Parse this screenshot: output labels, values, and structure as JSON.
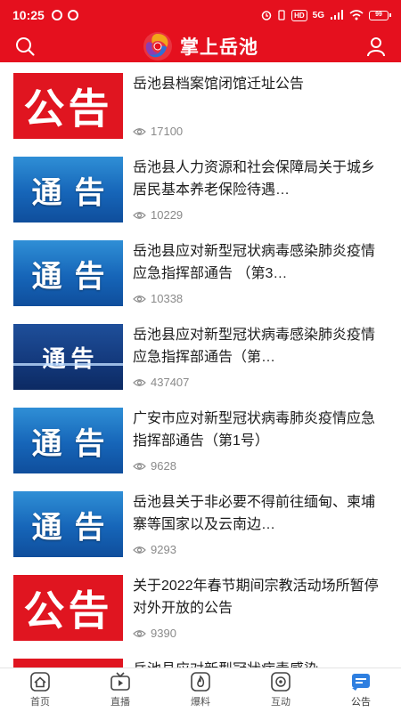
{
  "status_bar": {
    "time": "10:25",
    "network_badge": "HD",
    "signal_label": "5G",
    "battery": "99"
  },
  "header": {
    "title": "掌上岳池",
    "search_icon": "search-icon",
    "user_icon": "user-icon",
    "brand_colors": [
      "#e5101e",
      "#f2a51a",
      "#2e6fd6",
      "#8a3fb3"
    ]
  },
  "thumbnail_labels": {
    "gonggao": "公告",
    "tonggao": "通告"
  },
  "news": [
    {
      "thumb": "gonggao",
      "title": "岳池县档案馆闭馆迁址公告",
      "views": "17100"
    },
    {
      "thumb": "tonggao",
      "title": "岳池县人力资源和社会保障局关于城乡居民基本养老保险待遇…",
      "views": "10229"
    },
    {
      "thumb": "tonggao",
      "title": "岳池县应对新型冠状病毒感染肺炎疫情 应急指挥部通告 （第3…",
      "views": "10338"
    },
    {
      "thumb": "tonggao-dark",
      "title": "岳池县应对新型冠状病毒感染肺炎疫情应急指挥部通告（第…",
      "views": "437407"
    },
    {
      "thumb": "tonggao",
      "title": "广安市应对新型冠状病毒肺炎疫情应急指挥部通告（第1号）",
      "views": "9628"
    },
    {
      "thumb": "tonggao",
      "title": "岳池县关于非必要不得前往缅甸、柬埔寨等国家以及云南边…",
      "views": "9293"
    },
    {
      "thumb": "gonggao",
      "title": "关于2022年春节期间宗教活动场所暂停对外开放的公告",
      "views": "9390"
    },
    {
      "thumb": "gonggao",
      "title": "岳池县应对新型冠状病毒感染",
      "views": ""
    }
  ],
  "tabs": [
    {
      "label": "首页",
      "icon": "home-icon"
    },
    {
      "label": "直播",
      "icon": "tv-icon"
    },
    {
      "label": "爆料",
      "icon": "flame-icon"
    },
    {
      "label": "互动",
      "icon": "interact-icon"
    },
    {
      "label": "公告",
      "icon": "notice-icon"
    }
  ]
}
